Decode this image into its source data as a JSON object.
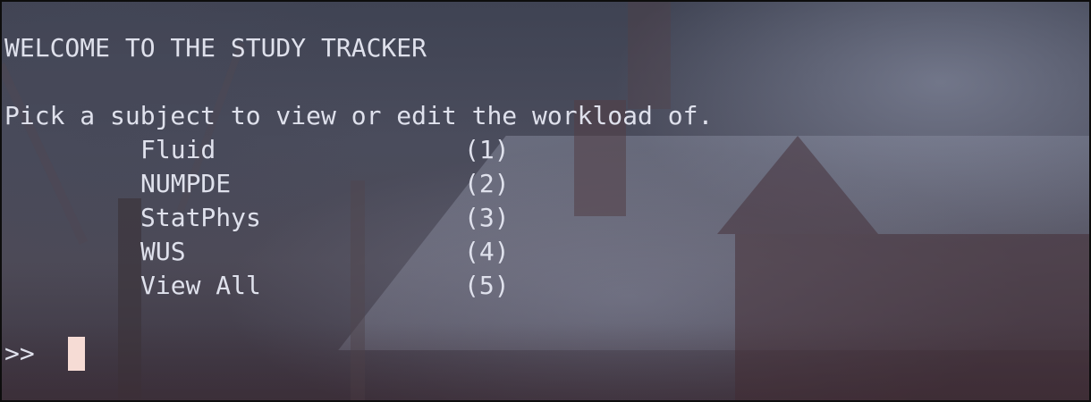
{
  "terminal": {
    "title_line": "WELCOME TO THE STUDY TRACKER",
    "instruction_line": "Pick a subject to view or edit the workload of.",
    "menu": [
      {
        "name": "Fluid",
        "key": "(1)"
      },
      {
        "name": "NUMPDE",
        "key": "(2)"
      },
      {
        "name": "StatPhys",
        "key": "(3)"
      },
      {
        "name": "WUS",
        "key": "(4)"
      },
      {
        "name": "View All",
        "key": "(5)"
      }
    ],
    "prompt": ">>"
  },
  "colors": {
    "text": "#dfe1ec",
    "cursor": "#f6dcd5",
    "border": "#0d0d0d"
  }
}
